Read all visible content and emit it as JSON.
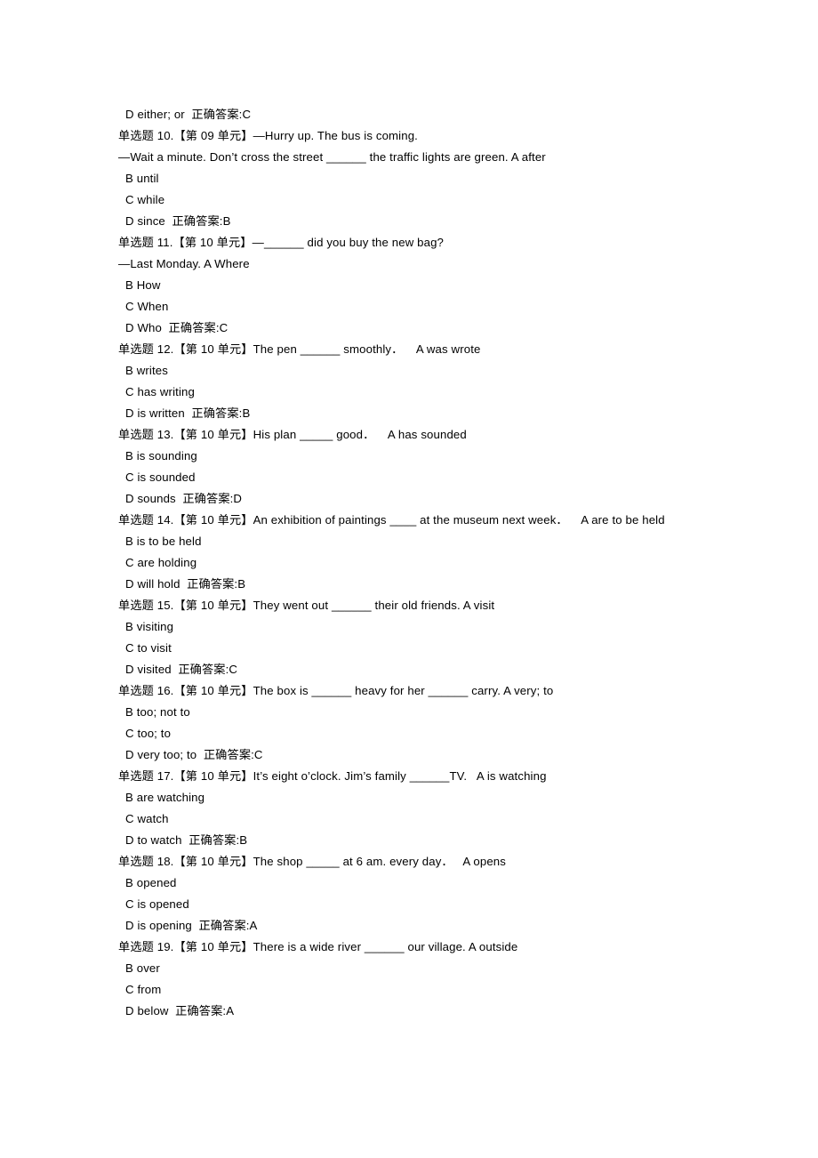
{
  "document": {
    "background_color": "#ffffff",
    "text_color": "#000000",
    "answer_label": "正确答案",
    "question_type_label": "单选题",
    "unit_prefix": "【第",
    "unit_suffix": "单元】"
  },
  "lines": [
    {
      "id": "l01",
      "kind": "option",
      "text": "D either; or  正确答案:C"
    },
    {
      "id": "l02",
      "kind": "stem",
      "text": "单选题 10.【第 09 单元】—Hurry up. The bus is coming."
    },
    {
      "id": "l03",
      "kind": "cont",
      "text": "—Wait a minute. Don’t cross the street ______ the traffic lights are green. A after"
    },
    {
      "id": "l04",
      "kind": "option",
      "text": "B until"
    },
    {
      "id": "l05",
      "kind": "option",
      "text": "C while"
    },
    {
      "id": "l06",
      "kind": "option",
      "text": "D since  正确答案:B"
    },
    {
      "id": "l07",
      "kind": "stem",
      "text": "单选题 11.【第 10 单元】—______ did you buy the new bag?"
    },
    {
      "id": "l08",
      "kind": "cont",
      "text": "—Last Monday. A Where"
    },
    {
      "id": "l09",
      "kind": "option",
      "text": "B How"
    },
    {
      "id": "l10",
      "kind": "option",
      "text": "C When"
    },
    {
      "id": "l11",
      "kind": "option",
      "text": "D Who  正确答案:C"
    },
    {
      "id": "l12",
      "kind": "stem",
      "text": "单选题 12.【第 10 单元】The pen ______ smoothly．    A was wrote"
    },
    {
      "id": "l13",
      "kind": "option",
      "text": "B writes"
    },
    {
      "id": "l14",
      "kind": "option",
      "text": "C has writing"
    },
    {
      "id": "l15",
      "kind": "option",
      "text": "D is written  正确答案:B"
    },
    {
      "id": "l16",
      "kind": "stem",
      "text": "单选题 13.【第 10 单元】His plan _____ good．    A has sounded"
    },
    {
      "id": "l17",
      "kind": "option",
      "text": "B is sounding"
    },
    {
      "id": "l18",
      "kind": "option",
      "text": "C is sounded"
    },
    {
      "id": "l19",
      "kind": "option",
      "text": "D sounds  正确答案:D"
    },
    {
      "id": "l20",
      "kind": "stem",
      "text": "单选题 14.【第 10 单元】An exhibition of paintings ____ at the museum next week．    A are to be held"
    },
    {
      "id": "l21",
      "kind": "option",
      "text": "B is to be held"
    },
    {
      "id": "l22",
      "kind": "option",
      "text": "C are holding"
    },
    {
      "id": "l23",
      "kind": "option",
      "text": "D will hold  正确答案:B"
    },
    {
      "id": "l24",
      "kind": "stem",
      "text": "单选题 15.【第 10 单元】They went out ______ their old friends. A visit"
    },
    {
      "id": "l25",
      "kind": "option",
      "text": "B visiting"
    },
    {
      "id": "l26",
      "kind": "option",
      "text": "C to visit"
    },
    {
      "id": "l27",
      "kind": "option",
      "text": "D visited  正确答案:C"
    },
    {
      "id": "l28",
      "kind": "stem",
      "text": "单选题 16.【第 10 单元】The box is ______ heavy for her ______ carry. A very; to"
    },
    {
      "id": "l29",
      "kind": "option",
      "text": "B too; not to"
    },
    {
      "id": "l30",
      "kind": "option",
      "text": "C too; to"
    },
    {
      "id": "l31",
      "kind": "option",
      "text": "D very too; to  正确答案:C"
    },
    {
      "id": "l32",
      "kind": "stem",
      "text": "单选题 17.【第 10 单元】It’s eight o’clock. Jim’s family ______TV.   A is watching"
    },
    {
      "id": "l33",
      "kind": "option",
      "text": "B are watching"
    },
    {
      "id": "l34",
      "kind": "option",
      "text": "C watch"
    },
    {
      "id": "l35",
      "kind": "option",
      "text": "D to watch  正确答案:B"
    },
    {
      "id": "l36",
      "kind": "stem",
      "text": "单选题 18.【第 10 单元】The shop _____ at 6 am. every day．   A opens"
    },
    {
      "id": "l37",
      "kind": "option",
      "text": "B opened"
    },
    {
      "id": "l38",
      "kind": "option",
      "text": "C is opened"
    },
    {
      "id": "l39",
      "kind": "option",
      "text": "D is opening  正确答案:A"
    },
    {
      "id": "l40",
      "kind": "stem",
      "text": "单选题 19.【第 10 单元】There is a wide river ______ our village. A outside"
    },
    {
      "id": "l41",
      "kind": "option",
      "text": "B over"
    },
    {
      "id": "l42",
      "kind": "option",
      "text": "C from"
    },
    {
      "id": "l43",
      "kind": "option",
      "text": "D below  正确答案:A"
    }
  ],
  "questions": [
    {
      "number": "10",
      "unit": "09",
      "type": "单选题",
      "stem": "—Hurry up. The bus is coming. —Wait a minute. Don’t cross the street ______ the traffic lights are green.",
      "options": [
        {
          "letter": "A",
          "text": "after"
        },
        {
          "letter": "B",
          "text": "until"
        },
        {
          "letter": "C",
          "text": "while"
        },
        {
          "letter": "D",
          "text": "since"
        }
      ],
      "correct_answer": "B"
    },
    {
      "number": "11",
      "unit": "10",
      "type": "单选题",
      "stem": "—______ did you buy the new bag? —Last Monday.",
      "options": [
        {
          "letter": "A",
          "text": "Where"
        },
        {
          "letter": "B",
          "text": "How"
        },
        {
          "letter": "C",
          "text": "When"
        },
        {
          "letter": "D",
          "text": "Who"
        }
      ],
      "correct_answer": "C"
    },
    {
      "number": "12",
      "unit": "10",
      "type": "单选题",
      "stem": "The pen ______ smoothly．",
      "options": [
        {
          "letter": "A",
          "text": "was wrote"
        },
        {
          "letter": "B",
          "text": "writes"
        },
        {
          "letter": "C",
          "text": "has writing"
        },
        {
          "letter": "D",
          "text": "is written"
        }
      ],
      "correct_answer": "B"
    },
    {
      "number": "13",
      "unit": "10",
      "type": "单选题",
      "stem": "His plan _____ good．",
      "options": [
        {
          "letter": "A",
          "text": "has sounded"
        },
        {
          "letter": "B",
          "text": "is sounding"
        },
        {
          "letter": "C",
          "text": "is sounded"
        },
        {
          "letter": "D",
          "text": "sounds"
        }
      ],
      "correct_answer": "D"
    },
    {
      "number": "14",
      "unit": "10",
      "type": "单选题",
      "stem": "An exhibition of paintings ____ at the museum next week．",
      "options": [
        {
          "letter": "A",
          "text": "are to be held"
        },
        {
          "letter": "B",
          "text": "is to be held"
        },
        {
          "letter": "C",
          "text": "are holding"
        },
        {
          "letter": "D",
          "text": "will hold"
        }
      ],
      "correct_answer": "B"
    },
    {
      "number": "15",
      "unit": "10",
      "type": "单选题",
      "stem": "They went out ______ their old friends.",
      "options": [
        {
          "letter": "A",
          "text": "visit"
        },
        {
          "letter": "B",
          "text": "visiting"
        },
        {
          "letter": "C",
          "text": "to visit"
        },
        {
          "letter": "D",
          "text": "visited"
        }
      ],
      "correct_answer": "C"
    },
    {
      "number": "16",
      "unit": "10",
      "type": "单选题",
      "stem": "The box is ______ heavy for her ______ carry.",
      "options": [
        {
          "letter": "A",
          "text": "very; to"
        },
        {
          "letter": "B",
          "text": "too; not to"
        },
        {
          "letter": "C",
          "text": "too; to"
        },
        {
          "letter": "D",
          "text": "very too; to"
        }
      ],
      "correct_answer": "C"
    },
    {
      "number": "17",
      "unit": "10",
      "type": "单选题",
      "stem": "It’s eight o’clock. Jim’s family ______TV.",
      "options": [
        {
          "letter": "A",
          "text": "is watching"
        },
        {
          "letter": "B",
          "text": "are watching"
        },
        {
          "letter": "C",
          "text": "watch"
        },
        {
          "letter": "D",
          "text": "to watch"
        }
      ],
      "correct_answer": "B"
    },
    {
      "number": "18",
      "unit": "10",
      "type": "单选题",
      "stem": "The shop _____ at 6 am. every day．",
      "options": [
        {
          "letter": "A",
          "text": "opens"
        },
        {
          "letter": "B",
          "text": "opened"
        },
        {
          "letter": "C",
          "text": "is opened"
        },
        {
          "letter": "D",
          "text": "is opening"
        }
      ],
      "correct_answer": "A"
    },
    {
      "number": "19",
      "unit": "10",
      "type": "单选题",
      "stem": "There is a wide river ______ our village.",
      "options": [
        {
          "letter": "A",
          "text": "outside"
        },
        {
          "letter": "B",
          "text": "over"
        },
        {
          "letter": "C",
          "text": "from"
        },
        {
          "letter": "D",
          "text": "below"
        }
      ],
      "correct_answer": "A"
    }
  ]
}
